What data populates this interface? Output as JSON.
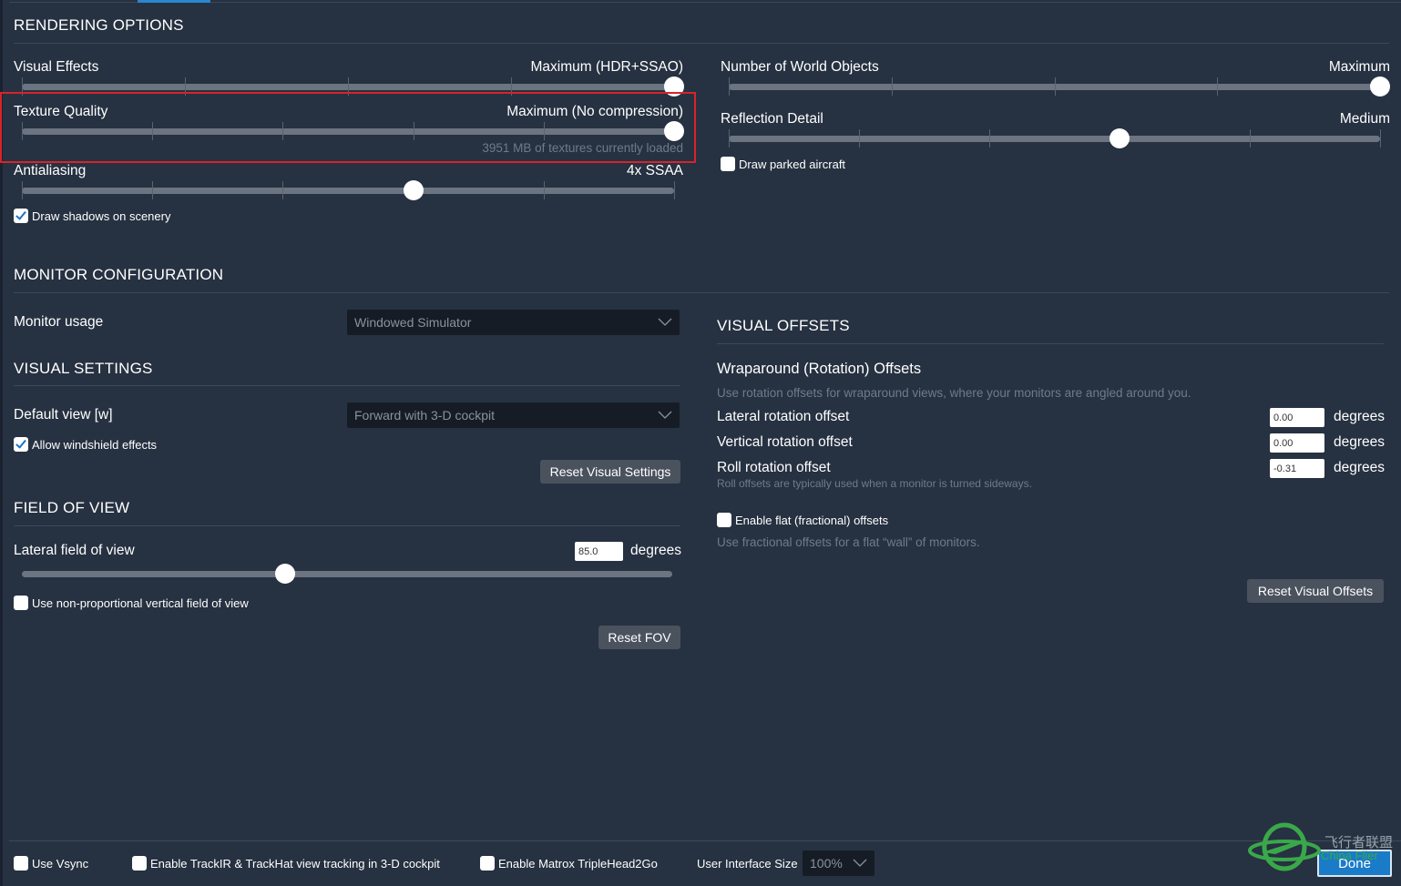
{
  "colors": {
    "background": "#263141",
    "accent": "#2a86d1",
    "highlight_box": "#d8232a",
    "checkbox_check": "#1e73c7",
    "done_button": "#1a7bc8"
  },
  "rendering": {
    "title": "RENDERING OPTIONS",
    "visual_effects": {
      "label": "Visual Effects",
      "value": "Maximum (HDR+SSAO)",
      "steps": 5,
      "index": 4
    },
    "texture_quality": {
      "label": "Texture Quality",
      "value": "Maximum (No compression)",
      "steps": 6,
      "index": 5,
      "note": "3951 MB of textures currently loaded"
    },
    "antialiasing": {
      "label": "Antialiasing",
      "value": "4x SSAA",
      "steps": 6,
      "index": 3
    },
    "draw_shadows": {
      "label": "Draw shadows on scenery",
      "checked": true
    },
    "world_objects": {
      "label": "Number of World Objects",
      "value": "Maximum",
      "steps": 5,
      "index": 4
    },
    "reflection_detail": {
      "label": "Reflection Detail",
      "value": "Medium",
      "steps": 6,
      "index": 3
    },
    "draw_parked_aircraft": {
      "label": "Draw parked aircraft",
      "checked": false
    }
  },
  "monitor": {
    "title": "MONITOR CONFIGURATION",
    "usage_label": "Monitor usage",
    "usage_value": "Windowed Simulator"
  },
  "visual_settings": {
    "title": "VISUAL SETTINGS",
    "default_view_label": "Default view [w]",
    "default_view_value": "Forward with 3-D cockpit",
    "windshield": {
      "label": "Allow windshield effects",
      "checked": true
    },
    "reset_label": "Reset Visual Settings"
  },
  "fov": {
    "title": "FIELD OF VIEW",
    "lateral_label": "Lateral field of view",
    "lateral_value": "85.0",
    "unit": "degrees",
    "slider_fraction": 0.405,
    "non_proportional": {
      "label": "Use non-proportional vertical field of view",
      "checked": false
    },
    "reset_label": "Reset FOV"
  },
  "visual_offsets": {
    "title": "VISUAL OFFSETS",
    "wraparound_title": "Wraparound (Rotation) Offsets",
    "wraparound_hint": "Use rotation offsets for wraparound views, where your monitors are angled around you.",
    "lateral": {
      "label": "Lateral rotation offset",
      "value": "0.00",
      "unit": "degrees"
    },
    "vertical": {
      "label": "Vertical rotation offset",
      "value": "0.00",
      "unit": "degrees"
    },
    "roll": {
      "label": "Roll rotation offset",
      "value": "-0.31",
      "unit": "degrees",
      "hint": "Roll offsets are typically used when a monitor is turned sideways."
    },
    "flat": {
      "label": "Enable flat (fractional) offsets",
      "checked": false,
      "hint": "Use fractional offsets for a flat “wall” of monitors."
    },
    "reset_label": "Reset Visual Offsets"
  },
  "footer": {
    "vsync": {
      "label": "Use Vsync",
      "checked": false
    },
    "trackir": {
      "label": "Enable TrackIR & TrackHat view tracking in 3-D cockpit",
      "checked": false
    },
    "matrox": {
      "label": "Enable Matrox TripleHead2Go",
      "checked": false
    },
    "ui_size_label": "User Interface Size",
    "ui_size_value": "100%",
    "done_label": "Done"
  },
  "watermark": {
    "cn": "飞行者联盟",
    "en": "China Flier"
  }
}
